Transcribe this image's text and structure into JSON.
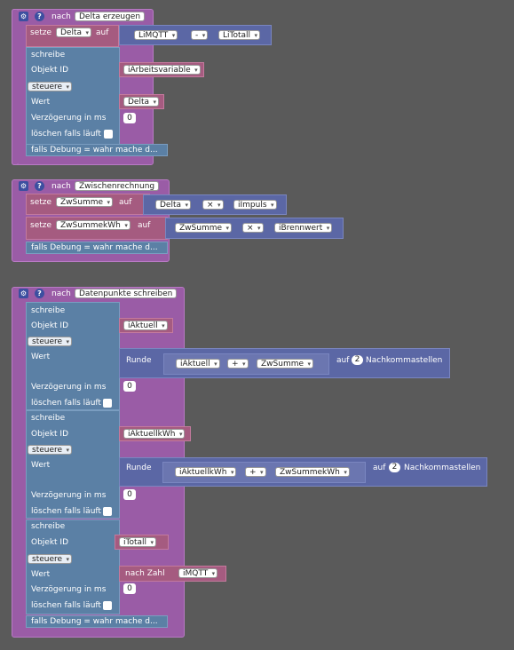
{
  "blocks": {
    "b1": {
      "prefix": "nach",
      "name": "Delta erzeugen",
      "setze": "setze",
      "var": "Delta",
      "auf": "auf",
      "left": "LiMQTT",
      "op": "-",
      "right": "LiTotall",
      "schreibe": "schreibe",
      "objekt_label": "Objekt ID",
      "objekt_value": "iArbeitsvariable",
      "mode": "steuere",
      "wert_label": "Wert",
      "wert_value": "Delta",
      "verz_label": "Verzögerung in ms",
      "verz_value": "0",
      "loeschen": "löschen falls läuft",
      "debug": "falls Debung = wahr mache d..."
    },
    "b2": {
      "prefix": "nach",
      "name": "Zwischenrechnung",
      "set1": {
        "setze": "setze",
        "var": "ZwSumme",
        "auf": "auf",
        "a": "Delta",
        "op": "×",
        "b": "iImpuls"
      },
      "set2": {
        "setze": "setze",
        "var": "ZwSummekWh",
        "auf": "auf",
        "a": "ZwSumme",
        "op": "×",
        "b": "iBrennwert"
      },
      "debug": "falls Debung = wahr mache d..."
    },
    "b3": {
      "prefix": "nach",
      "name": "Datenpunkte schreiben",
      "w1": {
        "schreibe": "schreibe",
        "objekt_label": "Objekt ID",
        "objekt_value": "iAktuell",
        "mode": "steuere",
        "wert_label": "Wert",
        "runde": "Runde",
        "a": "iAktuell",
        "op": "+",
        "b": "ZwSumme",
        "auf": "auf",
        "digits": "2",
        "nachkomma": "Nachkommastellen",
        "verz_label": "Verzögerung in ms",
        "verz_value": "0",
        "loeschen": "löschen falls läuft"
      },
      "w2": {
        "schreibe": "schreibe",
        "objekt_label": "Objekt ID",
        "objekt_value": "iAktuellkWh",
        "mode": "steuere",
        "wert_label": "Wert",
        "runde": "Runde",
        "a": "iAktuellkWh",
        "op": "+",
        "b": "ZwSummekWh",
        "auf": "auf",
        "digits": "2",
        "nachkomma": "Nachkommastellen",
        "verz_label": "Verzögerung in ms",
        "verz_value": "0",
        "loeschen": "löschen falls läuft"
      },
      "w3": {
        "schreibe": "schreibe",
        "objekt_label": "Objekt ID",
        "objekt_value": "iTotall",
        "mode": "steuere",
        "wert_label": "Wert",
        "nach_zahl": "nach Zahl",
        "value": "iMQTT",
        "verz_label": "Verzögerung in ms",
        "verz_value": "0",
        "loeschen": "löschen falls läuft"
      },
      "debug": "falls Debung = wahr mache d..."
    }
  },
  "icons": {
    "gear": "gear-icon",
    "help": "help-icon"
  },
  "colors": {
    "background": "#5a5a5a",
    "procedure": "#9a5ca6",
    "action": "#5b80a5",
    "variable": "#a55b80",
    "math": "#5b67a5"
  }
}
